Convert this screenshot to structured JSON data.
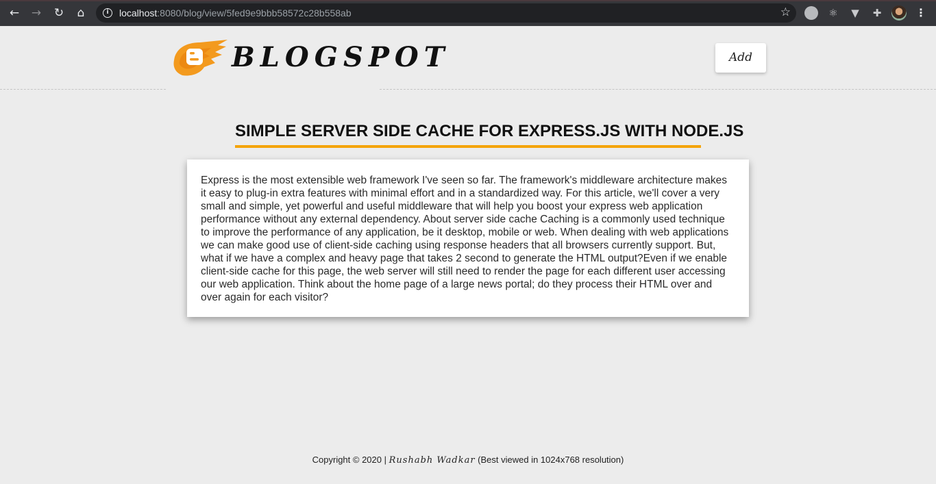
{
  "browser": {
    "url_host": "localhost",
    "url_rest": ":8080/blog/view/5fed9e9bbb58572c28b558ab",
    "icons": [
      "back-icon",
      "forward-icon",
      "reload-icon",
      "home-icon",
      "info-icon",
      "bookmark-star-icon",
      "extension-compass-icon",
      "react-devtools-icon",
      "vue-devtools-icon",
      "puzzle-extensions-icon",
      "profile-avatar",
      "menu-icon"
    ]
  },
  "header": {
    "logo_text": "BLOGSPOT",
    "add_label": "Add"
  },
  "post": {
    "title": "SIMPLE SERVER SIDE CACHE FOR EXPRESS.JS WITH NODE.JS",
    "body": "Express is the most extensible web framework I've seen so far. The framework's middleware architecture makes it easy to plug-in extra features with minimal effort and in a standardized way. For this article, we'll cover a very small and simple, yet powerful and useful middleware that will help you boost your express web application performance without any external dependency. About server side cache Caching is a commonly used technique to improve the performance of any application, be it desktop, mobile or web. When dealing with web applications we can make good use of client-side caching using response headers that all browsers currently support. But, what if we have a complex and heavy page that takes 2 second to generate the HTML output?Even if we enable client-side cache for this page, the web server will still need to render the page for each different user accessing our web application. Think about the home page of a large news portal; do they process their HTML over and over again for each visitor?"
  },
  "footer": {
    "copyright": "Copyright © 2020 | ",
    "author": "Rushabh Wadkar",
    "note": " (Best viewed in 1024x768 resolution)"
  },
  "colors": {
    "accent": "#f4a405",
    "logo_orange": "#f39a1e",
    "page_bg": "#ececec",
    "chrome_bg": "#35363a"
  }
}
